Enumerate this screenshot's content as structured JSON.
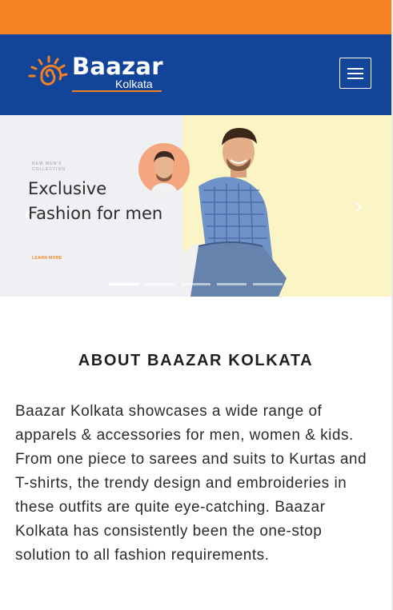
{
  "header": {
    "logo_word": "Baazar",
    "logo_city": "Kolkata",
    "menu_icon": "hamburger-menu-icon",
    "colors": {
      "top_strip": "#f58220",
      "header_bg": "#12449a",
      "accent": "#f58220"
    }
  },
  "hero": {
    "eyebrow": "New Men's Collection",
    "headline_line1": "Exclusive",
    "headline_line2": "Fashion for men",
    "cta": "Learn More",
    "prev_icon": "chevron-left-icon",
    "next_icon": "chevron-right-icon",
    "slides_count": 5,
    "active_slide": 1
  },
  "about": {
    "title": "ABOUT BAAZAR KOLKATA",
    "body": "Baazar Kolkata showcases a wide range of apparels & accessories for  men, women & kids. From one piece to sarees and suits to Kurtas and T-shirts, the trendy design and embroideries in these outfits are quite eye-catching. Baazar Kolkata has consistently been the one-stop solution to all fashion requirements."
  }
}
